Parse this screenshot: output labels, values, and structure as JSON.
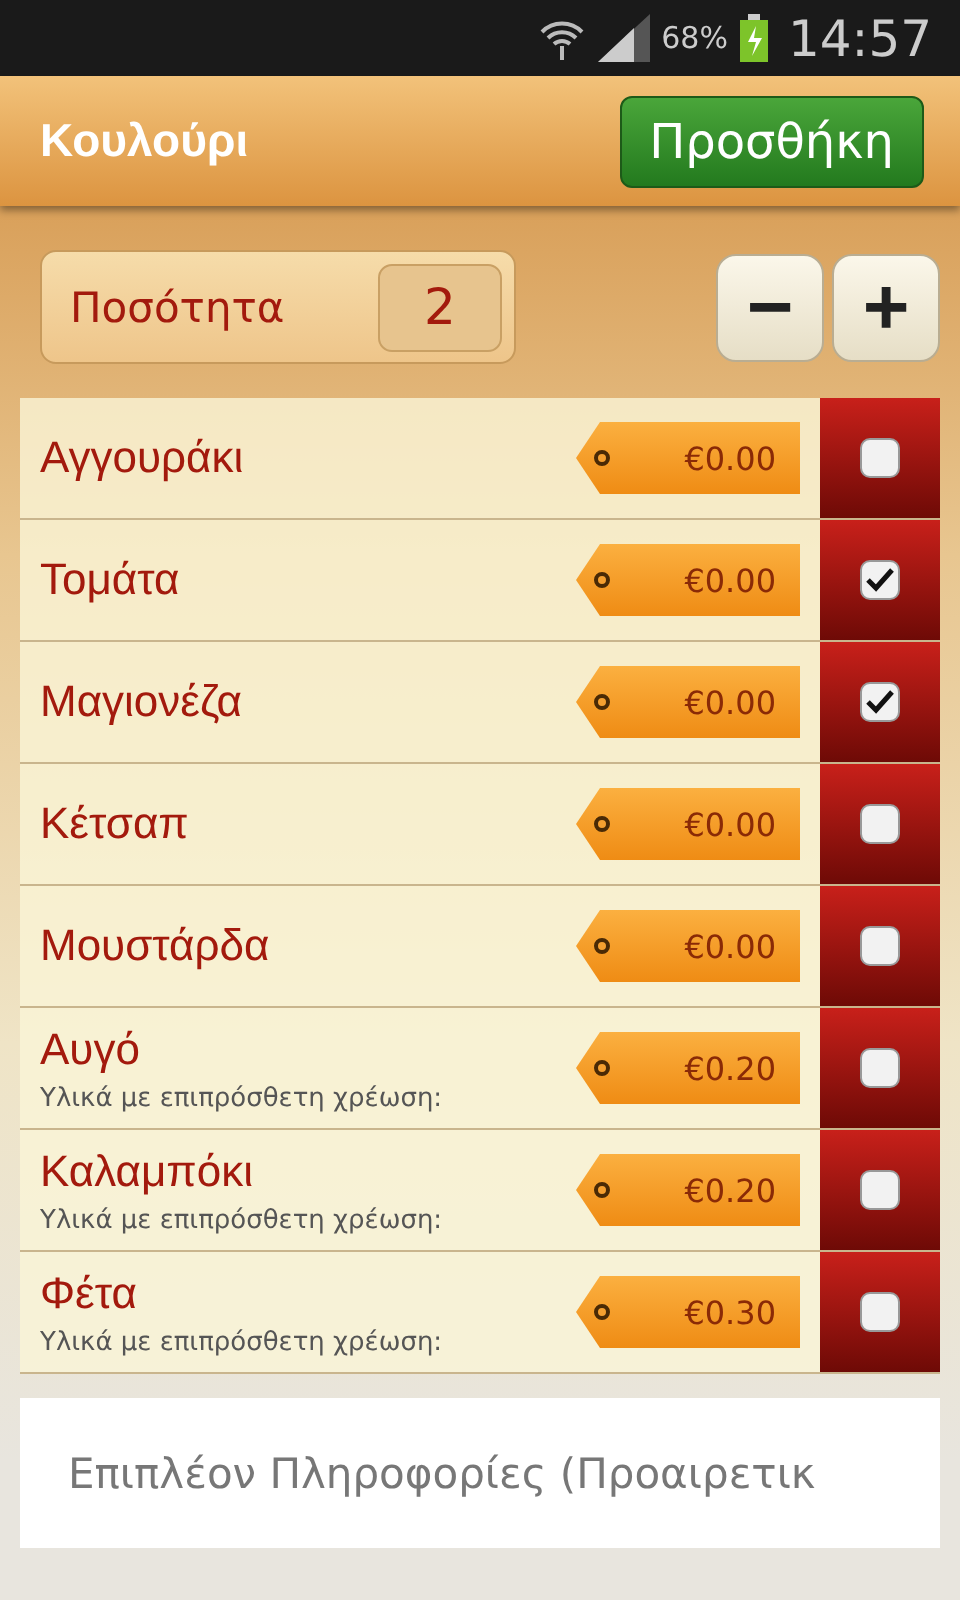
{
  "status_bar": {
    "battery": "68%",
    "time": "14:57"
  },
  "header": {
    "title": "Κουλούρι",
    "add_button": "Προσθήκη"
  },
  "quantity": {
    "label": "Ποσότητα",
    "value": "2",
    "decrease": "−",
    "increase": "+"
  },
  "ingredients": [
    {
      "name": "Αγγουράκι",
      "price": "€0.00",
      "checked": false
    },
    {
      "name": "Τομάτα",
      "price": "€0.00",
      "checked": true
    },
    {
      "name": "Μαγιονέζα",
      "price": "€0.00",
      "checked": true
    },
    {
      "name": "Κέτσαπ",
      "price": "€0.00",
      "checked": false
    },
    {
      "name": "Μουστάρδα",
      "price": "€0.00",
      "checked": false
    },
    {
      "name": "Αυγό",
      "note": "Υλικά με επιπρόσθετη χρέωση:",
      "price": "€0.20",
      "checked": false
    },
    {
      "name": "Καλαμπόκι",
      "note": "Υλικά με επιπρόσθετη χρέωση:",
      "price": "€0.20",
      "checked": false
    },
    {
      "name": "Φέτα",
      "note": "Υλικά με επιπρόσθετη χρέωση:",
      "price": "€0.30",
      "checked": false
    }
  ],
  "info_field": {
    "placeholder": "Επιπλέον Πληροφορίες (Προαιρετικ"
  }
}
